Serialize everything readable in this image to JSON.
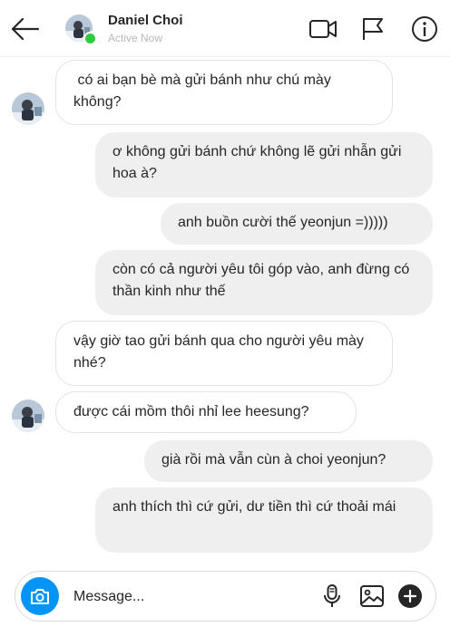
{
  "header": {
    "name": "Daniel Choi",
    "status": "Active Now",
    "icons": [
      "back-arrow-icon",
      "video-call-icon",
      "flag-icon",
      "info-icon"
    ]
  },
  "messages": [
    {
      "side": "in",
      "text": " có ai bạn bè mà gửi bánh như chú mày không?"
    },
    {
      "side": "out",
      "text": "ơ không gửi bánh chứ không lẽ gửi nhẫn gửi hoa à?"
    },
    {
      "side": "out",
      "text": "anh buồn cười thế yeonjun =)))))"
    },
    {
      "side": "out",
      "text": "còn có cả người yêu tôi góp vào, anh đừng có thần kinh như thế"
    },
    {
      "side": "in",
      "text": "vậy giờ tao gửi bánh qua cho người yêu mày nhé?"
    },
    {
      "side": "in",
      "text": "được cái mồm thôi nhỉ lee heesung?"
    },
    {
      "side": "out",
      "text": "già rồi mà vẫn cùn à choi yeonjun?"
    },
    {
      "side": "out",
      "text": "anh thích thì cứ gửi, dư tiền thì cứ thoải mái"
    }
  ],
  "composer": {
    "placeholder": "Message...",
    "icons": [
      "camera-icon",
      "microphone-icon",
      "gallery-icon",
      "plus-icon"
    ]
  },
  "colors": {
    "accent": "#0095f6",
    "online": "#2ecc40",
    "outgoing_bubble": "#efefef",
    "incoming_border": "#e3e3e3"
  }
}
